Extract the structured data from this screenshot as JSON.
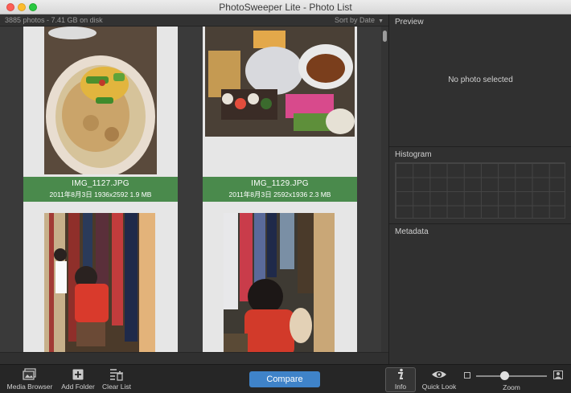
{
  "window": {
    "title": "PhotoSweeper Lite - Photo List"
  },
  "photo_list": {
    "summary": "3885 photos - 7.41 GB on disk",
    "sort_label": "Sort by Date",
    "photos": [
      {
        "name": "IMG_1127.JPG",
        "info": "2011年8月3日  1936x2592  1.9 MB"
      },
      {
        "name": "IMG_1129.JPG",
        "info": "2011年8月3日  2592x1936  2.3 MB"
      }
    ]
  },
  "sidebar": {
    "preview_title": "Preview",
    "no_photo": "No photo selected",
    "histogram_title": "Histogram",
    "metadata_title": "Metadata"
  },
  "toolbar": {
    "media_browser": "Media Browser",
    "add_folder": "Add Folder",
    "clear_list": "Clear List",
    "compare": "Compare",
    "info": "Info",
    "quick_look": "Quick Look",
    "zoom": "Zoom"
  },
  "colors": {
    "selected_caption": "#4a8a4c",
    "compare_button": "#3f83c9"
  },
  "icons": {
    "media_browser": "photo-stack-icon",
    "add_folder": "plus-square-icon",
    "clear_list": "list-trash-icon",
    "info": "info-icon",
    "quick_look": "eye-icon",
    "zoom_small": "small-photo-icon",
    "zoom_large": "large-photo-icon"
  }
}
